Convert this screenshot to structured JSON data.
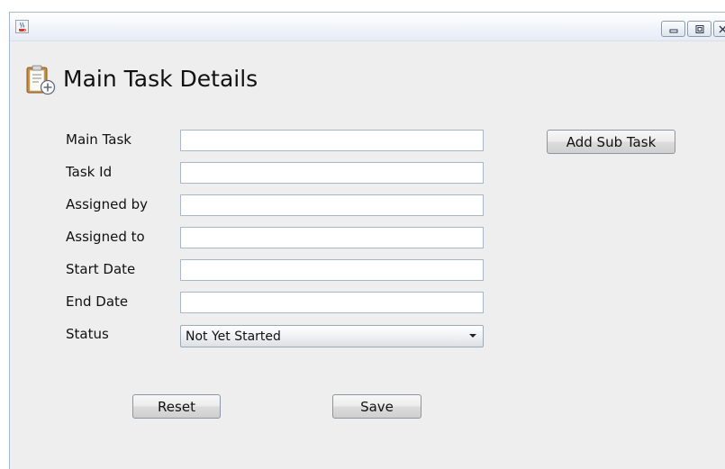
{
  "heading": "Main Task Details",
  "form": {
    "main_task_label": "Main Task",
    "task_id_label": "Task Id",
    "assigned_by_label": "Assigned by",
    "assigned_to_label": "Assigned to",
    "start_date_label": "Start Date",
    "end_date_label": "End Date",
    "status_label": "Status",
    "status_value": "Not Yet Started"
  },
  "buttons": {
    "add_sub_task": "Add Sub Task",
    "reset": "Reset",
    "save": "Save"
  },
  "icons": {
    "app": "java-coffee-icon",
    "heading": "task-clipboard-icon",
    "minimize": "minimize-icon",
    "maximize": "maximize-icon",
    "close": "close-icon"
  }
}
